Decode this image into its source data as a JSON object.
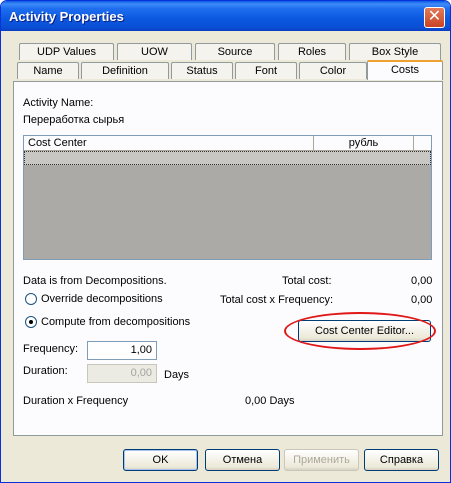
{
  "window": {
    "title": "Activity Properties",
    "close_glyph": "✕"
  },
  "tabs": {
    "row_back": [
      "UDP Values",
      "UOW",
      "Source",
      "Roles",
      "Box Style"
    ],
    "row_front": [
      "Name",
      "Definition",
      "Status",
      "Font",
      "Color",
      "Costs"
    ],
    "active": "Costs"
  },
  "activity": {
    "name_label": "Activity Name:",
    "name_value": "Переработка сырья"
  },
  "grid": {
    "col_cost_center": "Cost Center",
    "col_currency": "рубль"
  },
  "source_note": "Data is from Decompositions.",
  "options": {
    "override_label": "Override decompositions",
    "compute_label": "Compute from decompositions",
    "selected": "compute"
  },
  "totals": {
    "total_cost_label": "Total cost:",
    "total_cost_value": "0,00",
    "total_cost_freq_label": "Total cost x Frequency:",
    "total_cost_freq_value": "0,00"
  },
  "cost_center_editor_button": "Cost Center Editor...",
  "frequency": {
    "label": "Frequency:",
    "value": "1,00"
  },
  "duration": {
    "label": "Duration:",
    "value": "0,00",
    "unit": "Days"
  },
  "duration_x_frequency": {
    "label": "Duration x Frequency",
    "value": "0,00 Days"
  },
  "buttons": {
    "ok": "OK",
    "cancel": "Отмена",
    "apply": "Применить",
    "help": "Справка"
  },
  "colors": {
    "title_bar": "#0a5ae6",
    "annotation": "#e01818",
    "active_tab_accent": "#f0a030"
  }
}
